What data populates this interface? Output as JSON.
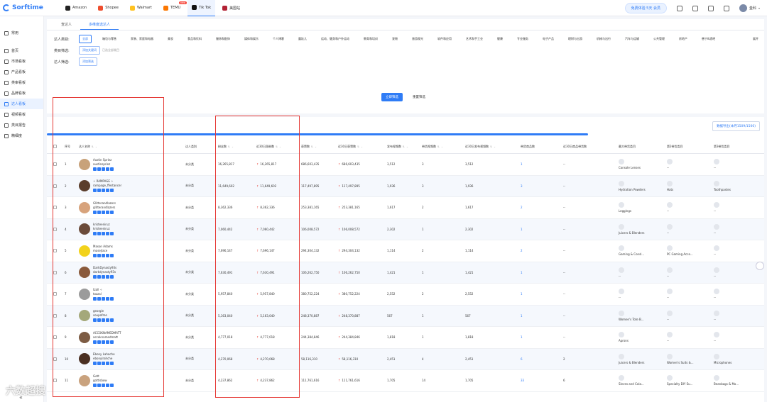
{
  "brand": {
    "name": "Sorftime",
    "accent": "#2f7cf6"
  },
  "platforms": [
    {
      "label": "Amazon",
      "color": "#222222"
    },
    {
      "label": "Shopee",
      "color": "#ee4d2d"
    },
    {
      "label": "Walmart",
      "color": "#ffc220"
    },
    {
      "label": "TEMU",
      "color": "#fb7701",
      "badge": "new"
    },
    {
      "label": "Tik Tok",
      "color": "#111111",
      "active": true
    },
    {
      "label": "美国站",
      "color": "#b22234"
    }
  ],
  "header": {
    "trial": "免费体验 5天 会员",
    "user": "金科"
  },
  "sidebar": {
    "items": [
      {
        "label": "常用"
      },
      {
        "label": "首页"
      },
      {
        "label": "市场看板"
      },
      {
        "label": "产品看板"
      },
      {
        "label": "类审看板"
      },
      {
        "label": "品牌看板"
      },
      {
        "label": "达人看板",
        "active": true
      },
      {
        "label": "视频看板"
      },
      {
        "label": "类目报告"
      },
      {
        "label": "精细度"
      }
    ]
  },
  "tabs": [
    {
      "label": "查达人"
    },
    {
      "label": "多维度选达人",
      "active": true
    }
  ],
  "filters": {
    "category_label": "达人类别:",
    "categories": [
      "全部",
      "箱包与零售",
      "家装、家庭和电器",
      "美妆",
      "食品和饮料",
      "服饰和配饰",
      "媒体和娱乐",
      "个人博客",
      "露娃儿",
      "运动、健身和户外运动",
      "教育和培训",
      "宠物",
      "旅游观光",
      "软件和应用",
      "艺术和手工业",
      "健康",
      "专业服务",
      "电子产品",
      "理财与出游",
      "机械与出行",
      "汽车与运输",
      "公共管理",
      "房地产",
      "慈宁&酒吧"
    ],
    "more": "展开",
    "product_label": "类目筛选:",
    "product_btn": "添加关键词",
    "product_hint": "已选全部类目",
    "kol_label": "达人筛选:",
    "kol_btn": "添加筛选"
  },
  "actions": {
    "search": "立即筛选",
    "reset": "重置筛选"
  },
  "export": "数据导出(本月1509/1500)",
  "table": {
    "headers": [
      "序号",
      "达人名称",
      "达人类别",
      "粉丝数",
      "近30日涨粉数",
      "获赞数",
      "近30日获赞数",
      "发布视频数",
      "带货视频数",
      "近30日发布视频数",
      "带货商品数",
      "近30日商品带货数",
      "最大带货类目",
      "第2带货类目",
      "第3带货类目"
    ],
    "rows": [
      {
        "idx": "1",
        "name": "Austin Spriez",
        "handle": "austinspriez",
        "ava": "#c8a27a",
        "cls": "未分类",
        "fans": "16,265,817",
        "fans30": "16,265,817",
        "likes": "686,603,435",
        "likes30": "686,603,435",
        "videos": "3,512",
        "sell_videos": "3",
        "videos30": "3,512",
        "products": "1",
        "products30": "--",
        "p1": "Console Lenses",
        "p2": "--",
        "p3": "--"
      },
      {
        "idx": "2",
        "name": "✧ RAMPAGE ✧",
        "handle": "rampage_ffestancer",
        "ava": "#5a3d2b",
        "cls": "未分类",
        "fans": "11,649,602",
        "fans30": "11,649,602",
        "likes": "117,497,895",
        "likes30": "117,497,895",
        "videos": "1,936",
        "sell_videos": "3",
        "videos30": "1,936",
        "products": "3",
        "products30": "--",
        "p1": "Hydration Powders",
        "p2": "Hats",
        "p3": "Toothpastes"
      },
      {
        "idx": "3",
        "name": "Glitterandlazers",
        "handle": "glitterandlazers",
        "ava": "#d7a37c",
        "cls": "未分类",
        "fans": "8,362,336",
        "fans30": "8,362,336",
        "likes": "253,381,165",
        "likes30": "253,381,165",
        "videos": "1,617",
        "sell_videos": "2",
        "videos30": "1,617",
        "products": "2",
        "products30": "--",
        "p1": "Leggings",
        "p2": "--",
        "p3": "--"
      },
      {
        "idx": "4",
        "name": "kristeeniruz",
        "handle": "kristeeniruz",
        "ava": "#6b4b3a",
        "cls": "未分类",
        "fans": "7,060,442",
        "fans30": "7,060,442",
        "likes": "106,008,572",
        "likes30": "106,008,572",
        "videos": "2,302",
        "sell_videos": "1",
        "videos30": "2,302",
        "products": "1",
        "products30": "--",
        "p1": "Juicers & Blenders",
        "p2": "--",
        "p3": "--"
      },
      {
        "idx": "5",
        "name": "Mason Adams",
        "handle": "masejlace",
        "ava": "#f2d21b",
        "cls": "未分类",
        "fans": "7,696,147",
        "fans30": "7,696,147",
        "likes": "294,304,132",
        "likes30": "294,304,132",
        "videos": "1,114",
        "sell_videos": "2",
        "videos30": "1,114",
        "products": "2",
        "products30": "--",
        "p1": "Gaming & Consl...",
        "p2": "PC Gaming Acce...",
        "p3": "--"
      },
      {
        "idx": "6",
        "name": "DarkDynasty93s",
        "handle": "darkdynasty93s",
        "ava": "#8a5a3c",
        "cls": "未分类",
        "fans": "7,630,491",
        "fans30": "7,630,491",
        "likes": "106,262,750",
        "likes30": "106,262,750",
        "videos": "1,421",
        "sell_videos": "1",
        "videos30": "1,421",
        "products": "1",
        "products30": "--",
        "p1": "--",
        "p2": "--",
        "p3": "--"
      },
      {
        "idx": "7",
        "name": "tzall ✧",
        "handle": "tozzal",
        "ava": "#9b9b9b",
        "cls": "未分类",
        "fans": "5,957,840",
        "fans30": "5,957,840",
        "likes": "380,752,224",
        "likes30": "380,752,224",
        "videos": "2,552",
        "sell_videos": "2",
        "videos30": "2,552",
        "products": "1",
        "products30": "--",
        "p1": "--",
        "p2": "--",
        "p3": "--"
      },
      {
        "idx": "8",
        "name": "georgie",
        "handle": "soupofme",
        "ava": "#a4a87a",
        "cls": "未分类",
        "fans": "5,163,040",
        "fans30": "5,163,040",
        "likes": "248,370,887",
        "likes30": "248,370,887",
        "videos": "567",
        "sell_videos": "1",
        "videos30": "567",
        "products": "1",
        "products30": "--",
        "p1": "Women's Tote B...",
        "p2": "--",
        "p3": "--"
      },
      {
        "idx": "9",
        "name": "ACCOKNAMEDMATT",
        "handle": "accoknamedmatt",
        "ava": "#7d5c44",
        "cls": "未分类",
        "fans": "4,777,018",
        "fans30": "4,777,018",
        "likes": "244,384,846",
        "likes30": "244,384,846",
        "videos": "1,818",
        "sell_videos": "1",
        "videos30": "1,818",
        "products": "1",
        "products30": "--",
        "p1": "Aprons",
        "p2": "--",
        "p3": "--"
      },
      {
        "idx": "10",
        "name": "Ebony Lahache",
        "handle": "ebonylrahche",
        "ava": "#4a2f22",
        "cls": "未分类",
        "fans": "4,270,068",
        "fans30": "4,270,068",
        "likes": "58,116,310",
        "likes30": "58,116,310",
        "videos": "2,451",
        "sell_videos": "4",
        "videos30": "2,451",
        "products": "6",
        "products30": "2",
        "p1": "Juicers & Blenders",
        "p2": "Women's Suits &...",
        "p3": "Microphones"
      },
      {
        "idx": "11",
        "name": "Gott",
        "handle": "gottlsbow",
        "ava": "#c9a27e",
        "cls": "未分类",
        "fans": "4,237,862",
        "fans30": "4,237,862",
        "likes": "111,761,616",
        "likes30": "111,761,616",
        "videos": "1,705",
        "sell_videos": "14",
        "videos30": "1,705",
        "products": "33",
        "products30": "6",
        "p1": "Sieves and Cola...",
        "p2": "Specialty DIY Su...",
        "p3": "Beanbags & Mo..."
      }
    ]
  },
  "watermark": "六数超搜"
}
